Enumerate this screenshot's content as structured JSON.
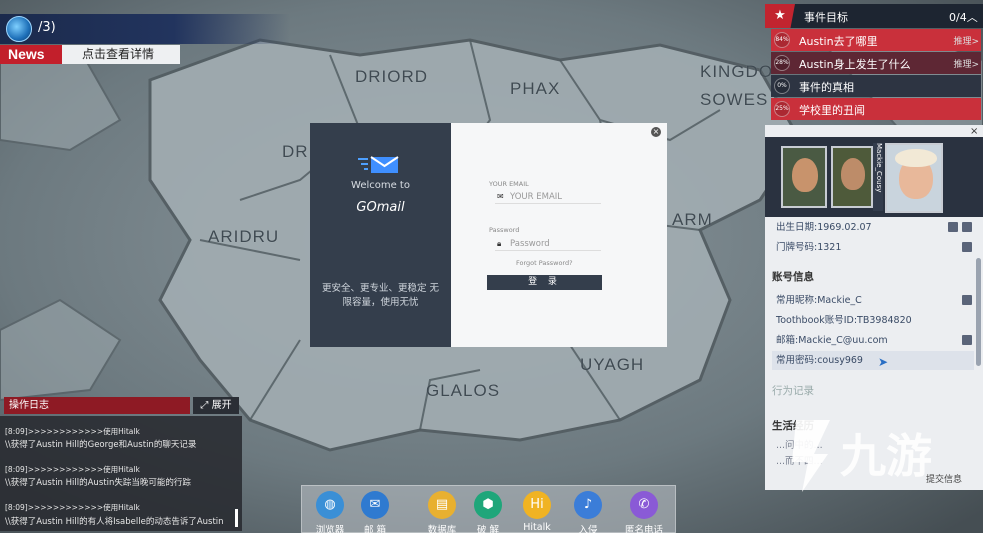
{
  "header": {
    "counter": "/3)",
    "news_badge": "News",
    "news_link": "点击查看详情"
  },
  "map_labels": [
    "DRIORD",
    "PHAX",
    "KINGDO",
    "SOWES",
    "DR",
    "ARIDRU",
    "ARM",
    "UYAGH",
    "GLALOS"
  ],
  "login_dialog": {
    "welcome": "Welcome to",
    "brand": "GOmail",
    "slogan": "更安全、更专业、更稳定 无限容量，使用无忧",
    "email_label": "YOUR EMAIL",
    "email_placeholder": "YOUR EMAIL",
    "password_label": "Password",
    "password_placeholder": "Password",
    "forgot": "Forgot Password?",
    "login_button": "登 录",
    "close": "×"
  },
  "objectives": {
    "title": "事件目标",
    "count": "0/4",
    "items": [
      {
        "pct": "84%",
        "label": "Austin去了哪里",
        "hint": "推理>",
        "color": "#c9303b"
      },
      {
        "pct": "28%",
        "label": "Austin身上发生了什么",
        "hint": "推理>",
        "color": "#5e2734"
      },
      {
        "pct": "0%",
        "label": "事件的真相",
        "hint": "",
        "color": "#2d3442"
      },
      {
        "pct": "25%",
        "label": "学校里的丑闻",
        "hint": "",
        "color": "#c9303b"
      }
    ]
  },
  "profile": {
    "close": "×",
    "tag_name": "Mackie_Cousy",
    "info_top": [
      "出生日期:1969.02.07",
      "门牌号码:1321"
    ],
    "section_account": "账号信息",
    "account": [
      "常用昵称:Mackie_C",
      "Toothbook账号ID:TB3984820",
      "邮箱:Mackie_C@uu.com",
      "常用密码:cousy969"
    ],
    "section_behavior": "行为记录",
    "section_life": "生活经历",
    "life_items": [
      "...问中的...",
      "...而不四..."
    ],
    "submit": "提交信息"
  },
  "log": {
    "title": "操作日志",
    "expand": "展开",
    "lines": [
      "[8:09]>>>>>>>>>>>>使用Hitalk",
      "\\\\获得了Austin Hill的George和Austin的聊天记录",
      "[8:09]>>>>>>>>>>>>使用Hitalk",
      "\\\\获得了Austin Hill的Austin失踪当晚可能的行踪",
      "[8:09]>>>>>>>>>>>>使用Hitalk",
      "\\\\获得了Austin Hill的有人将Isabelle的动态告诉了Austin"
    ]
  },
  "dock": [
    {
      "label": "浏览器",
      "icon": "globe-icon",
      "glyph": "◍",
      "color": "#3a8fd6"
    },
    {
      "label": "邮 箱",
      "icon": "mail-icon",
      "glyph": "✉",
      "color": "#2f7ad0"
    },
    {
      "label": "数据库",
      "icon": "database-icon",
      "glyph": "▤",
      "color": "#e8b030"
    },
    {
      "label": "破 解",
      "icon": "shield-icon",
      "glyph": "⬢",
      "color": "#1fa67a"
    },
    {
      "label": "Hitalk",
      "icon": "hitalk-icon",
      "glyph": "Hi",
      "color": "#f0b323"
    },
    {
      "label": "入侵",
      "icon": "hook-icon",
      "glyph": "♪",
      "color": "#3b7dd8"
    },
    {
      "label": "匿名电话",
      "icon": "phone-icon",
      "glyph": "✆",
      "color": "#8a5ad6"
    }
  ],
  "watermark": "九游"
}
